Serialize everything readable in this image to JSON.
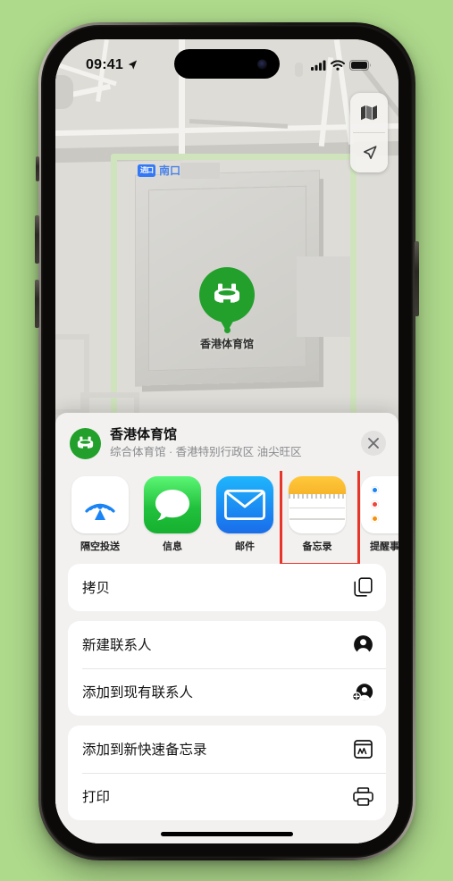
{
  "status_bar": {
    "time": "09:41",
    "location_arrow_icon": "location-arrow-icon",
    "cellular_icon": "cellular-bars-icon",
    "wifi_icon": "wifi-icon",
    "battery_icon": "battery-full-icon"
  },
  "map": {
    "pin_label": "香港体育馆",
    "pin_color": "#22a02b",
    "transit_badge_text": "进口",
    "transit_label": "南口",
    "transit_color": "#3478f6",
    "controls": {
      "layers_icon": "map-layers-icon",
      "locate_icon": "locate-arrow-icon"
    }
  },
  "share_sheet": {
    "title": "香港体育馆",
    "subtitle": "综合体育馆 · 香港特别行政区 油尖旺区",
    "close_icon": "close-icon",
    "avatar_icon": "stadium-icon",
    "apps": [
      {
        "label": "隔空投送",
        "icon": "airdrop-icon",
        "highlighted": false
      },
      {
        "label": "信息",
        "icon": "messages-icon",
        "highlighted": false
      },
      {
        "label": "邮件",
        "icon": "mail-icon",
        "highlighted": false
      },
      {
        "label": "备忘录",
        "icon": "notes-icon",
        "highlighted": true
      },
      {
        "label": "提醒事项",
        "icon": "reminders-icon",
        "highlighted": false
      }
    ],
    "highlight_color": "#e8352a",
    "action_groups": [
      {
        "rows": [
          {
            "label": "拷贝",
            "icon": "copy-icon"
          }
        ]
      },
      {
        "rows": [
          {
            "label": "新建联系人",
            "icon": "new-contact-icon"
          },
          {
            "label": "添加到现有联系人",
            "icon": "add-existing-contact-icon"
          }
        ]
      },
      {
        "rows": [
          {
            "label": "添加到新快速备忘录",
            "icon": "quick-note-icon"
          },
          {
            "label": "打印",
            "icon": "print-icon"
          }
        ]
      }
    ]
  }
}
